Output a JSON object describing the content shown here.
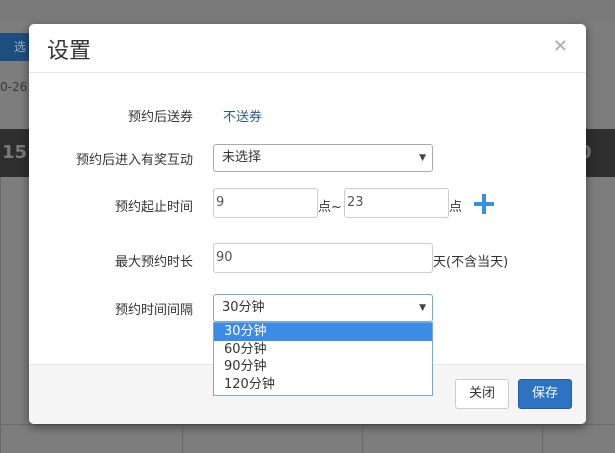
{
  "background": {
    "filter_button": "选",
    "date_fragment": "0-26",
    "band_left": "15",
    "band_right": "0"
  },
  "modal": {
    "title": "设置",
    "close_icon": "×"
  },
  "form": {
    "gift_label": "预约后送券",
    "gift_value": "不送券",
    "interaction_label": "预约后进入有奖互动",
    "interaction_value": "未选择",
    "time_range_label": "预约起止时间",
    "start_value": "9",
    "start_unit": "点~",
    "end_value": "23",
    "end_unit": "点",
    "add_icon": "plus-icon",
    "max_duration_label": "最大预约时长",
    "max_duration_value": "90",
    "max_duration_unit": "天(不含当天)",
    "interval_label": "预约时间间隔",
    "interval_value": "30分钟",
    "interval_options": [
      "30分钟",
      "60分钟",
      "90分钟",
      "120分钟"
    ],
    "interval_selected_index": 0
  },
  "footer": {
    "close_label": "关闭",
    "save_label": "保存"
  },
  "colors": {
    "primary": "#2d73c2",
    "link": "#2a5d8c",
    "highlight": "#3b8ce8",
    "plus": "#3a8fe0"
  }
}
